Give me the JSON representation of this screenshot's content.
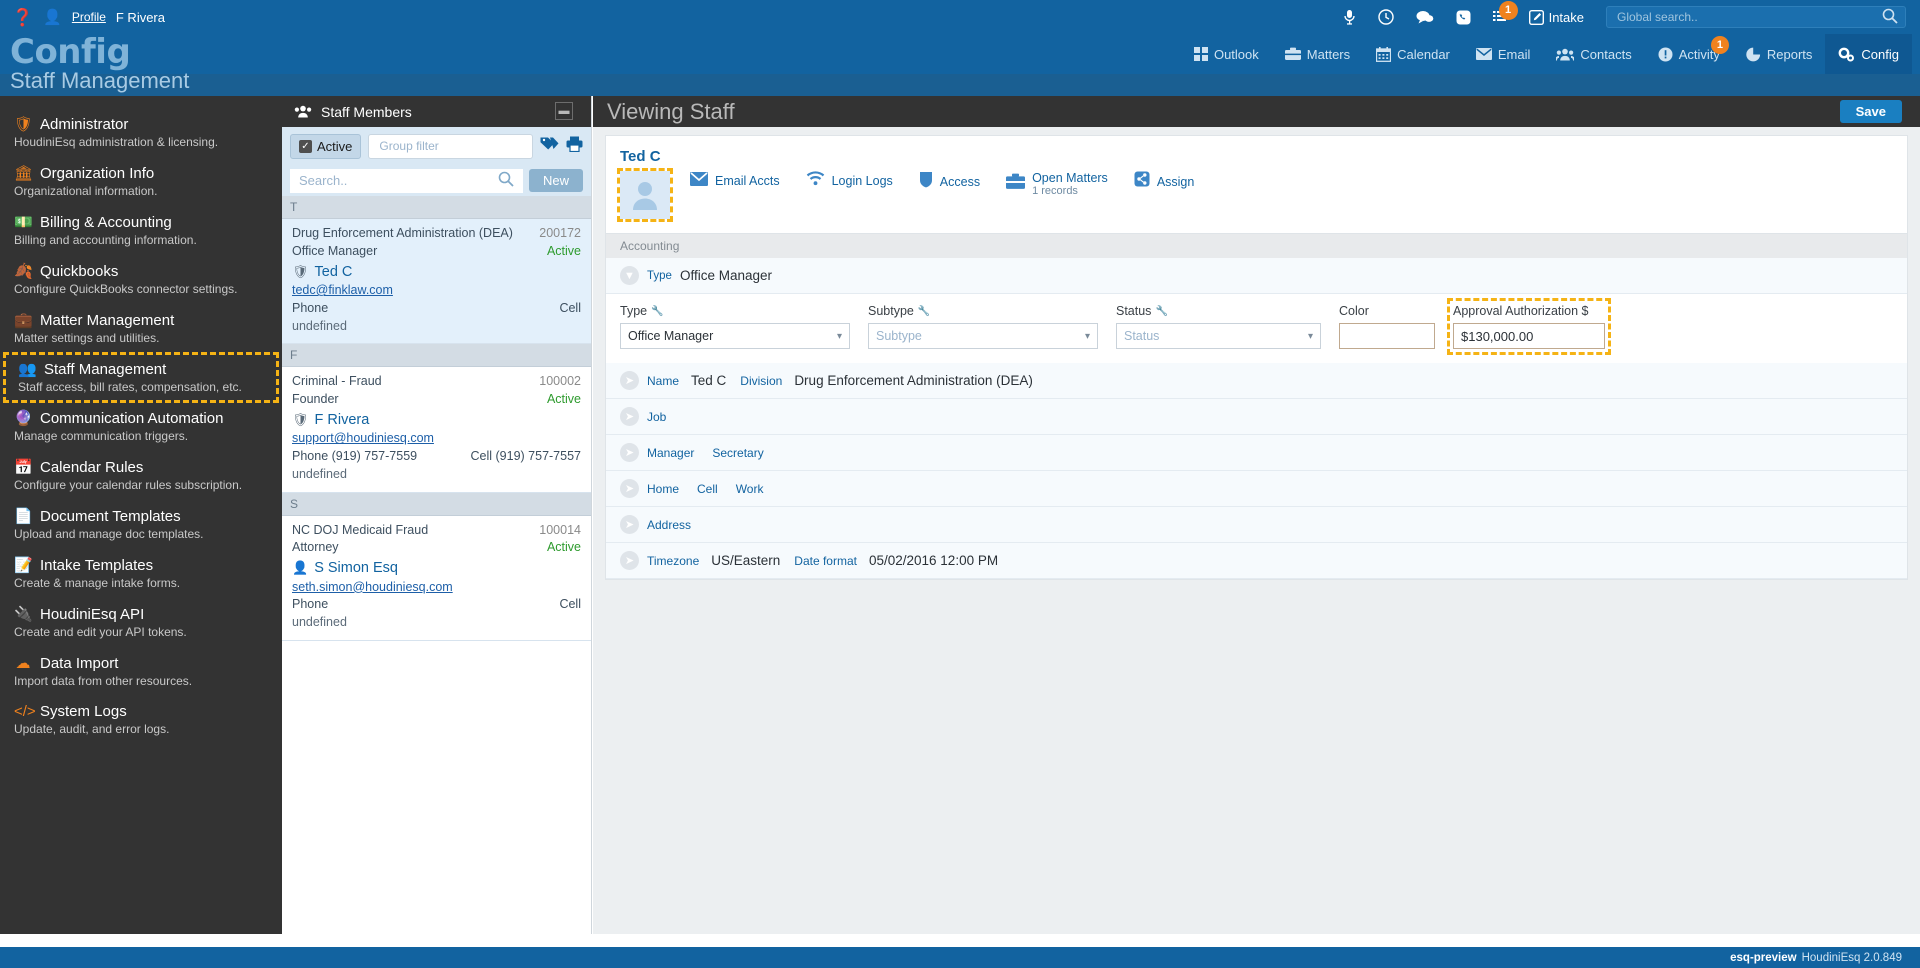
{
  "topbar": {
    "help_icon": "question-circle-icon",
    "profile_link": "Profile",
    "username": "F Rivera",
    "icons": [
      "microphone-icon",
      "clock-icon",
      "chat-icon",
      "phone-icon",
      "list-icon"
    ],
    "list_badge": "1",
    "intake_label": "Intake",
    "search_placeholder": "Global search..",
    "search_value": ""
  },
  "brand": {
    "title": "Config",
    "subtitle": "Staff Management"
  },
  "nav": {
    "items": [
      {
        "label": "Outlook",
        "icon": "grid-icon",
        "active": false
      },
      {
        "label": "Matters",
        "icon": "briefcase-icon",
        "active": false
      },
      {
        "label": "Calendar",
        "icon": "calendar-icon",
        "active": false
      },
      {
        "label": "Email",
        "icon": "envelope-icon",
        "active": false
      },
      {
        "label": "Contacts",
        "icon": "users-icon",
        "active": false
      },
      {
        "label": "Activity",
        "icon": "exclamation-icon",
        "active": false,
        "badge": "1"
      },
      {
        "label": "Reports",
        "icon": "pie-chart-icon",
        "active": false
      },
      {
        "label": "Config",
        "icon": "gears-icon",
        "active": true
      }
    ]
  },
  "sidebar": {
    "items": [
      {
        "title": "Administrator",
        "desc": "HoudiniEsq administration & licensing.",
        "icon": "shield-user-icon"
      },
      {
        "title": "Organization Info",
        "desc": "Organizational information.",
        "icon": "bank-icon"
      },
      {
        "title": "Billing & Accounting",
        "desc": "Billing and accounting information.",
        "icon": "money-icon"
      },
      {
        "title": "Quickbooks",
        "desc": "Configure QuickBooks connector settings.",
        "icon": "leaf-icon"
      },
      {
        "title": "Matter Management",
        "desc": "Matter settings and utilities.",
        "icon": "briefcase-icon"
      },
      {
        "title": "Staff Management",
        "desc": "Staff access, bill rates, compensation, etc.",
        "icon": "users-icon"
      },
      {
        "title": "Communication Automation",
        "desc": "Manage communication triggers.",
        "icon": "magic-wand-icon"
      },
      {
        "title": "Calendar Rules",
        "desc": "Configure your calendar rules subscription.",
        "icon": "calendar-icon"
      },
      {
        "title": "Document Templates",
        "desc": "Upload and manage doc templates.",
        "icon": "document-icon"
      },
      {
        "title": "Intake Templates",
        "desc": "Create & manage intake forms.",
        "icon": "pencil-square-icon"
      },
      {
        "title": "HoudiniEsq API",
        "desc": "Create and edit your API tokens.",
        "icon": "plug-icon"
      },
      {
        "title": "Data Import",
        "desc": "Import data from other resources.",
        "icon": "cloud-upload-icon"
      },
      {
        "title": "System Logs",
        "desc": "Update, audit, and error logs.",
        "icon": "code-icon"
      }
    ],
    "highlight_index": 5
  },
  "staff_panel": {
    "header": "Staff Members",
    "active_label": "Active",
    "group_filter_placeholder": "Group filter",
    "group_filter_value": "",
    "search_placeholder": "Search..",
    "search_value": "",
    "new_button": "New",
    "tag_icon": "tags-icon",
    "print_icon": "printer-icon",
    "groups": [
      {
        "letter": "T",
        "rows": [
          {
            "org": "Drug Enforcement Administration (DEA)",
            "id": "200172",
            "role": "Office Manager",
            "status": "Active",
            "name": "Ted C",
            "email": "tedc@finklaw.com",
            "phone": "Phone",
            "cell": "Cell",
            "undefined": "undefined",
            "selected": true
          }
        ]
      },
      {
        "letter": "F",
        "rows": [
          {
            "org": "Criminal - Fraud",
            "id": "100002",
            "role": "Founder",
            "status": "Active",
            "name": "F Rivera",
            "email": "support@houdiniesq.com",
            "phone": "Phone (919) 757-7559",
            "cell": "Cell (919) 757-7557",
            "undefined": "undefined",
            "selected": false
          }
        ]
      },
      {
        "letter": "S",
        "rows": [
          {
            "org": "NC DOJ Medicaid Fraud",
            "id": "100014",
            "role": "Attorney",
            "status": "Active",
            "name": "S Simon Esq",
            "email": "seth.simon@houdiniesq.com",
            "phone": "Phone",
            "cell": "Cell",
            "undefined": "undefined",
            "selected": false
          }
        ]
      }
    ]
  },
  "main": {
    "title": "Viewing Staff",
    "save_label": "Save",
    "record_name": "Ted C",
    "tabs": [
      {
        "label": "Email Accts",
        "icon": "envelope-icon",
        "sub": ""
      },
      {
        "label": "Login Logs",
        "icon": "wifi-icon",
        "sub": ""
      },
      {
        "label": "Access",
        "icon": "shield-icon",
        "sub": ""
      },
      {
        "label": "Open Matters",
        "icon": "briefcase-icon",
        "sub": "1 records"
      },
      {
        "label": "Assign",
        "icon": "share-icon",
        "sub": ""
      }
    ],
    "section_label": "Accounting",
    "type_row": {
      "label": "Type",
      "value": "Office Manager"
    },
    "fields": {
      "type_label": "Type",
      "type_value": "Office Manager",
      "subtype_label": "Subtype",
      "subtype_placeholder": "Subtype",
      "status_label": "Status",
      "status_placeholder": "Status",
      "color_label": "Color",
      "color_value": "",
      "approval_label": "Approval Authorization $",
      "approval_value": "$130,000.00"
    },
    "rows": [
      {
        "l1": "Name",
        "v1": "Ted C",
        "l2": "Division",
        "v2": "Drug Enforcement Administration (DEA)"
      },
      {
        "l1": "Job",
        "v1": "",
        "l2": "",
        "v2": ""
      },
      {
        "l1": "Manager",
        "v1": "",
        "l2": "Secretary",
        "v2": ""
      },
      {
        "l1": "Home",
        "v1": "",
        "l2": "Cell",
        "v2": "",
        "l3": "Work"
      },
      {
        "l1": "Address",
        "v1": "",
        "l2": "",
        "v2": ""
      },
      {
        "l1": "Timezone",
        "v1": "US/Eastern",
        "l2": "Date format",
        "v2": "05/02/2016 12:00 PM"
      }
    ]
  },
  "statusbar": {
    "env": "esq-preview",
    "version": "HoudiniEsq 2.0.849"
  },
  "colors": {
    "primary": "#1263a0",
    "accent": "#f0821e",
    "highlight": "#f5b315",
    "dark": "#333333"
  }
}
